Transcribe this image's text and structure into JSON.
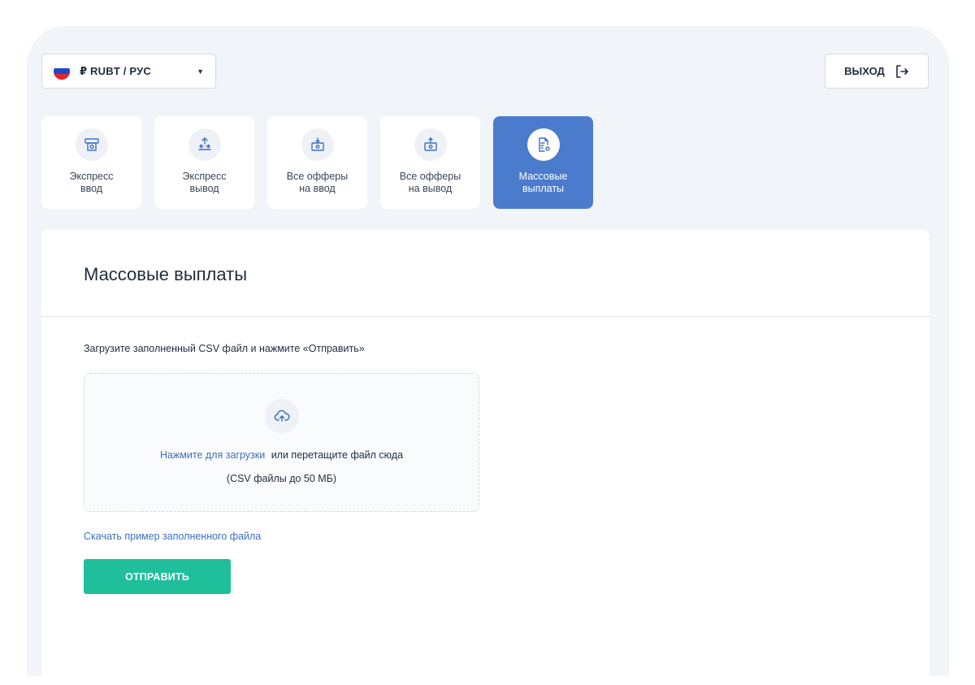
{
  "header": {
    "currency_label": "₽ RUBT / РУС",
    "logout_label": "ВЫХОД"
  },
  "tiles": [
    {
      "label": "Экспресс\nввод",
      "icon": "atm-icon",
      "active": false
    },
    {
      "label": "Экспресс\nвывод",
      "icon": "transfer-out-icon",
      "active": false
    },
    {
      "label": "Все офферы\nна ввод",
      "icon": "money-in-icon",
      "active": false
    },
    {
      "label": "Все офферы\nна вывод",
      "icon": "money-out-icon",
      "active": false
    },
    {
      "label": "Массовые\nвыплаты",
      "icon": "document-gear-icon",
      "active": true
    }
  ],
  "main": {
    "title": "Массовые выплаты",
    "instruction": "Загрузите заполненный CSV файл и нажмите «Отправить»",
    "upload_link": "Нажмите для загрузки",
    "upload_text": "или перетащите файл сюда",
    "upload_hint": "(CSV файлы до 50 МБ)",
    "download_link": "Скачать пример заполненного файла",
    "submit_label": "ОТПРАВИТЬ"
  },
  "colors": {
    "accent": "#4b7bcc",
    "submit": "#1fbf9b",
    "link": "#3d6fc4",
    "background": "#f1f4f9"
  }
}
